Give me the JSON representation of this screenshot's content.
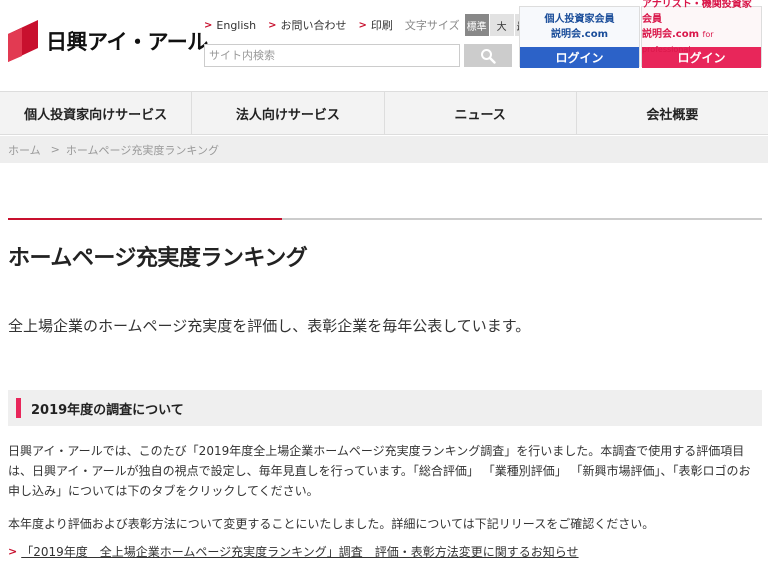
{
  "header": {
    "logo_text": "日興アイ・アール",
    "util_links": [
      "English",
      "お問い合わせ",
      "印刷"
    ],
    "font_size_label": "文字サイズ",
    "font_size_options": [
      "標準",
      "大",
      "最大"
    ],
    "search_placeholder": "サイト内検索",
    "member_individual": {
      "line1": "個人投資家会員",
      "line2": "説明会.com",
      "button": "ログイン"
    },
    "member_analyst": {
      "line1": "アナリスト・機関投資家会員",
      "line2": "説明会.com",
      "line2_suffix": "for professional",
      "button": "ログイン"
    }
  },
  "nav": {
    "items": [
      "個人投資家向けサービス",
      "法人向けサービス",
      "ニュース",
      "会社概要"
    ]
  },
  "breadcrumb": {
    "home": "ホーム",
    "sep": ">",
    "current": "ホームページ充実度ランキング"
  },
  "main": {
    "title": "ホームページ充実度ランキング",
    "lead": "全上場企業のホームページ充実度を評価し、表彰企業を毎年公表しています。",
    "section_title": "2019年度の調査について",
    "para1": "日興アイ・アールでは、このたび「2019年度全上場企業ホームページ充実度ランキング調査」を行いました。本調査で使用する評価項目は、日興アイ・アールが独自の視点で設定し、毎年見直しを行っています。「総合評価」 「業種別評価」 「新興市場評価」、「表彰ロゴのお申し込み」については下のタブをクリックしてください。",
    "para2": "本年度より評価および表彰方法について変更することにいたしました。詳細については下記リリースをご確認ください。",
    "release_link": "「2019年度　全上場企業ホームページ充実度ランキング」調査　評価・表彰方法変更に関するお知らせ"
  },
  "colors": {
    "brand_red": "#c8102e",
    "individual_blue": "#2c62c8",
    "analyst_pink": "#e8265a"
  }
}
